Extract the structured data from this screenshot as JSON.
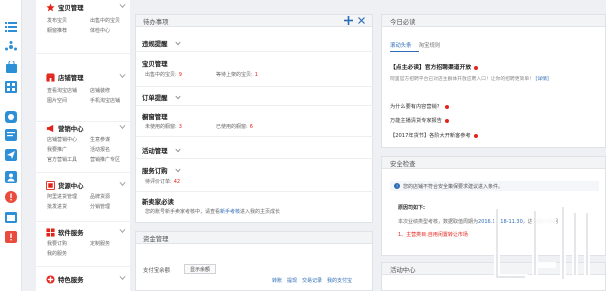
{
  "rail_icons": [
    "list-icon",
    "network-icon",
    "bag-icon",
    "grid-icon",
    "chat-icon",
    "message-icon",
    "send-icon",
    "person-icon",
    "warning-icon",
    "calendar-icon",
    "alert-icon"
  ],
  "menu": {
    "groups": [
      {
        "icon": "star-icon",
        "title": "宝贝管理",
        "rows": [
          [
            "发布宝贝",
            "出售中的宝贝"
          ],
          [
            "橱窗推荐",
            "体检中心"
          ]
        ]
      },
      {
        "icon": "store-icon",
        "title": "店铺管理",
        "rows": [
          [
            "查看淘宝店铺",
            "店铺装修"
          ],
          [
            "图片空间",
            "手机淘宝店铺"
          ]
        ]
      },
      {
        "icon": "megaphone-icon",
        "title": "营销中心",
        "rows": [
          [
            "店铺营销中心",
            "生意参谋"
          ],
          [
            "我要推广",
            "活动报名"
          ],
          [
            "官方营销工具",
            "营销推广专区"
          ]
        ]
      },
      {
        "icon": "resource-icon",
        "title": "货源中心",
        "rows": [
          [
            "阿里进货管理",
            "品牌货源"
          ],
          [
            "批发进货",
            "分销管理"
          ]
        ]
      },
      {
        "icon": "software-icon",
        "title": "软件服务",
        "rows": [
          [
            "我要订购",
            "定制服务"
          ],
          [
            "我的服务"
          ]
        ]
      },
      {
        "icon": "special-icon",
        "title": "特色服务",
        "rows": []
      }
    ]
  },
  "todo": {
    "title": "待办事项",
    "sections": {
      "reminder": "违规提醒",
      "goods": "宝贝管理",
      "order": "订单提醒",
      "store": "橱窗管理",
      "activity": "活动管理",
      "service": "服务订购",
      "newbie": "新卖家必读"
    },
    "goods_items": [
      {
        "label": "出售中的宝贝:",
        "value": "9"
      },
      {
        "label": "等待上架的宝贝:",
        "value": "1"
      }
    ],
    "store_items": [
      {
        "label": "未使用的橱窗:",
        "value": "3"
      },
      {
        "label": "已使用的橱窗:",
        "value": "6"
      }
    ],
    "service_item": {
      "label": "待评价订单:",
      "value": "42"
    },
    "newbie_text": "您的账号新手卖家考核中，请查看",
    "newbie_link": "新手考核",
    "newbie_tail": "进入我的主页成长"
  },
  "fund": {
    "title": "资金管理",
    "pay_label": "支付宝余额",
    "button": "显示余额",
    "links": [
      "转账",
      "提现",
      "交易记录",
      "我的支付宝"
    ]
  },
  "right": {
    "must_read": {
      "title": "今日必读",
      "tabs": [
        "滚动头条",
        "淘宝规则"
      ],
      "headline": "【点主必读】官方招聘渠道开放",
      "headline_sub": "阿里官方招聘平台已对店主群体开放应聘入口！让你的招聘更简单！",
      "headline_link": "[详情]",
      "items": [
        "为什么要有内容营销？",
        "万能主播清货专家报告",
        "【2017年货节】各阶大开新客参考"
      ]
    },
    "security": {
      "title": "安全检查",
      "alert": "您的店铺不符合安全策保要求建议进入条件。"
    },
    "notice": {
      "title": "原因司如下:",
      "line1_a": "本次业绩类型考核，数据取值周期为",
      "line1_b": "2016.11.18-11.30",
      "line1_c": "，达到期内到期",
      "line2": "1、主营类目:自用闲置转让市场"
    },
    "activity": {
      "title": "活动中心"
    }
  }
}
